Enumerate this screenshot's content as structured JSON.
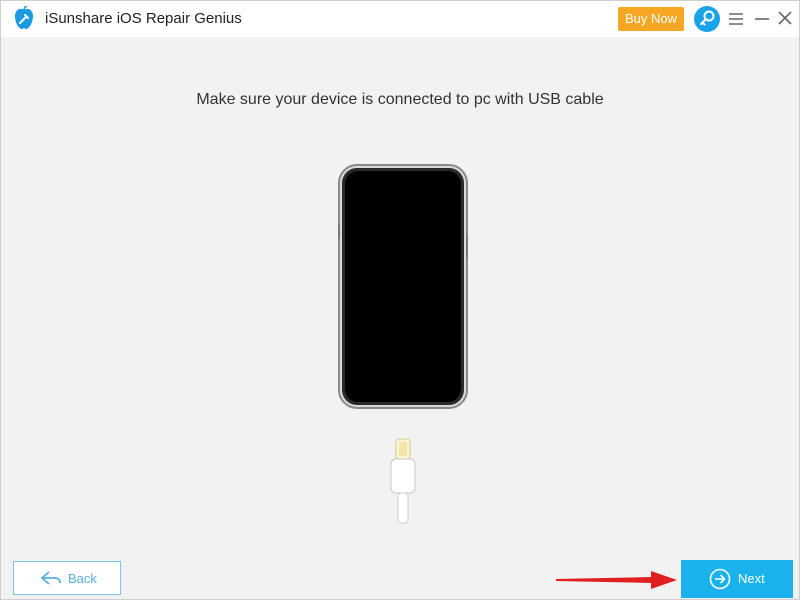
{
  "titlebar": {
    "app_title": "iSunshare iOS Repair Genius",
    "buy_label": "Buy Now",
    "icons": [
      "app-logo-icon",
      "key-icon",
      "menu-icon",
      "minimize-icon",
      "close-icon"
    ]
  },
  "main": {
    "instruction": "Make sure your device is connected to pc with USB cable"
  },
  "footer": {
    "back_label": "Back",
    "next_label": "Next"
  },
  "colors": {
    "accent": "#1ab2ec",
    "buy": "#f5a623",
    "annotation_arrow": "#e02020"
  }
}
